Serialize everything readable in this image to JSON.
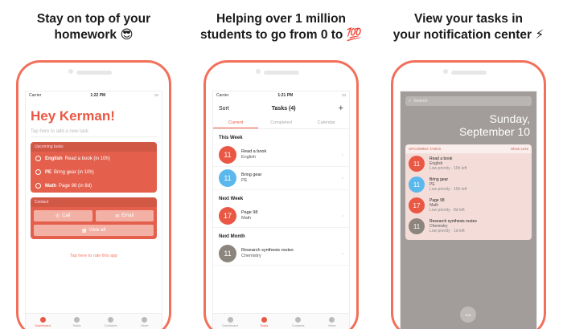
{
  "colors": {
    "accent": "#ea5844",
    "phone_frame": "#f2705a",
    "orange": "#ea5844",
    "blue": "#5ab8ec",
    "gray": "#8c857d"
  },
  "panels": [
    {
      "headline": "Stay on top of your\nhomework 😎"
    },
    {
      "headline": "Helping over 1 million\nstudents to go from 0 to 💯"
    },
    {
      "headline": "View your tasks in\nyour notification center ⚡"
    }
  ],
  "screen1": {
    "status": {
      "carrier": "Carrier",
      "time": "1:22 PM"
    },
    "greeting": "Hey Kerman!",
    "add_placeholder": "Tap here to add a new task",
    "upcoming_header": "Upcoming tasks",
    "tasks": [
      {
        "subject": "English",
        "text": "Read a book (in 10h)"
      },
      {
        "subject": "PE",
        "text": "Bring gear (in 10h)"
      },
      {
        "subject": "Math",
        "text": "Page 98 (in 8d)"
      }
    ],
    "contact_header": "Contact",
    "call_label": "Call",
    "email_label": "Email",
    "viewall_label": "View all",
    "rate_label": "Tap here to rate this app",
    "tabs": [
      "Dashboard",
      "Tasks",
      "Contacts",
      "More"
    ]
  },
  "screen2": {
    "status": {
      "carrier": "Carrier",
      "time": "1:21 PM"
    },
    "sort_label": "Sort",
    "title": "Tasks (4)",
    "plus": "+",
    "segments": [
      "Current",
      "Completed",
      "Calendar"
    ],
    "sections": [
      {
        "label": "This Week",
        "tasks": [
          {
            "day": "11",
            "title": "Read a book",
            "subject": "English",
            "color": "orange"
          },
          {
            "day": "11",
            "title": "Bring gear",
            "subject": "PE",
            "color": "blue"
          }
        ]
      },
      {
        "label": "Next Week",
        "tasks": [
          {
            "day": "17",
            "title": "Page 98",
            "subject": "Math",
            "color": "orange"
          }
        ]
      },
      {
        "label": "Next Month",
        "tasks": [
          {
            "day": "11",
            "title": "Research synthesis routes",
            "subject": "Chemistry",
            "color": "gray"
          }
        ]
      }
    ],
    "tabs": [
      "Dashboard",
      "Tasks",
      "Contacts",
      "More"
    ]
  },
  "screen3": {
    "search_placeholder": "Search",
    "day": "Sunday,",
    "date": "September 10",
    "widget_title": "UPCOMING TASKS",
    "widget_action": "Show Less",
    "tasks": [
      {
        "day": "11",
        "title": "Read a book",
        "subject": "English",
        "meta": "Low priority · 10h left",
        "color": "orange"
      },
      {
        "day": "11",
        "title": "Bring gear",
        "subject": "PE",
        "meta": "Low priority · 10h left",
        "color": "blue"
      },
      {
        "day": "17",
        "title": "Page 98",
        "subject": "Math",
        "meta": "Low priority · 8d left",
        "color": "orange"
      },
      {
        "day": "11",
        "title": "Research synthesis routes",
        "subject": "Chemistry",
        "meta": "Low priority · 1d left",
        "color": "gray"
      }
    ],
    "edit_label": "Edit"
  }
}
